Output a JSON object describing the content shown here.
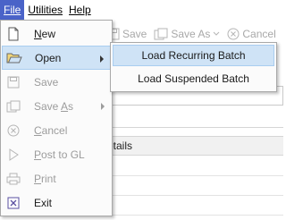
{
  "menubar": {
    "file": "File",
    "utilities": "Utilities",
    "help": "Help"
  },
  "toolbar": {
    "save": "Save",
    "save_as": "Save As",
    "cancel": "Cancel"
  },
  "background": {
    "grid_header": "etails"
  },
  "file_menu": {
    "items": [
      {
        "label": "New",
        "icon": "new-document-icon",
        "enabled": true
      },
      {
        "label": "Open",
        "icon": "open-folder-icon",
        "enabled": true,
        "submenu": true,
        "highlighted": true
      },
      {
        "label": "Save",
        "icon": "save-icon",
        "enabled": false
      },
      {
        "label": "Save As",
        "icon": "save-as-icon",
        "enabled": false,
        "submenu": true
      },
      {
        "label": "Cancel",
        "icon": "cancel-icon",
        "enabled": false
      },
      {
        "label": "Post to GL",
        "icon": "post-icon",
        "enabled": false
      },
      {
        "label": "Print",
        "icon": "print-icon",
        "enabled": false
      },
      {
        "label": "Exit",
        "icon": "exit-icon",
        "enabled": true
      }
    ]
  },
  "open_submenu": {
    "items": [
      {
        "label": "Load Recurring Batch",
        "highlighted": true
      },
      {
        "label": "Load Suspended Batch",
        "highlighted": false
      }
    ]
  },
  "colors": {
    "menu_active": "#4a63c8",
    "highlight_bg": "#cfe3f6",
    "highlight_border": "#a9cdf0",
    "disabled_text": "#9c9c9c"
  }
}
